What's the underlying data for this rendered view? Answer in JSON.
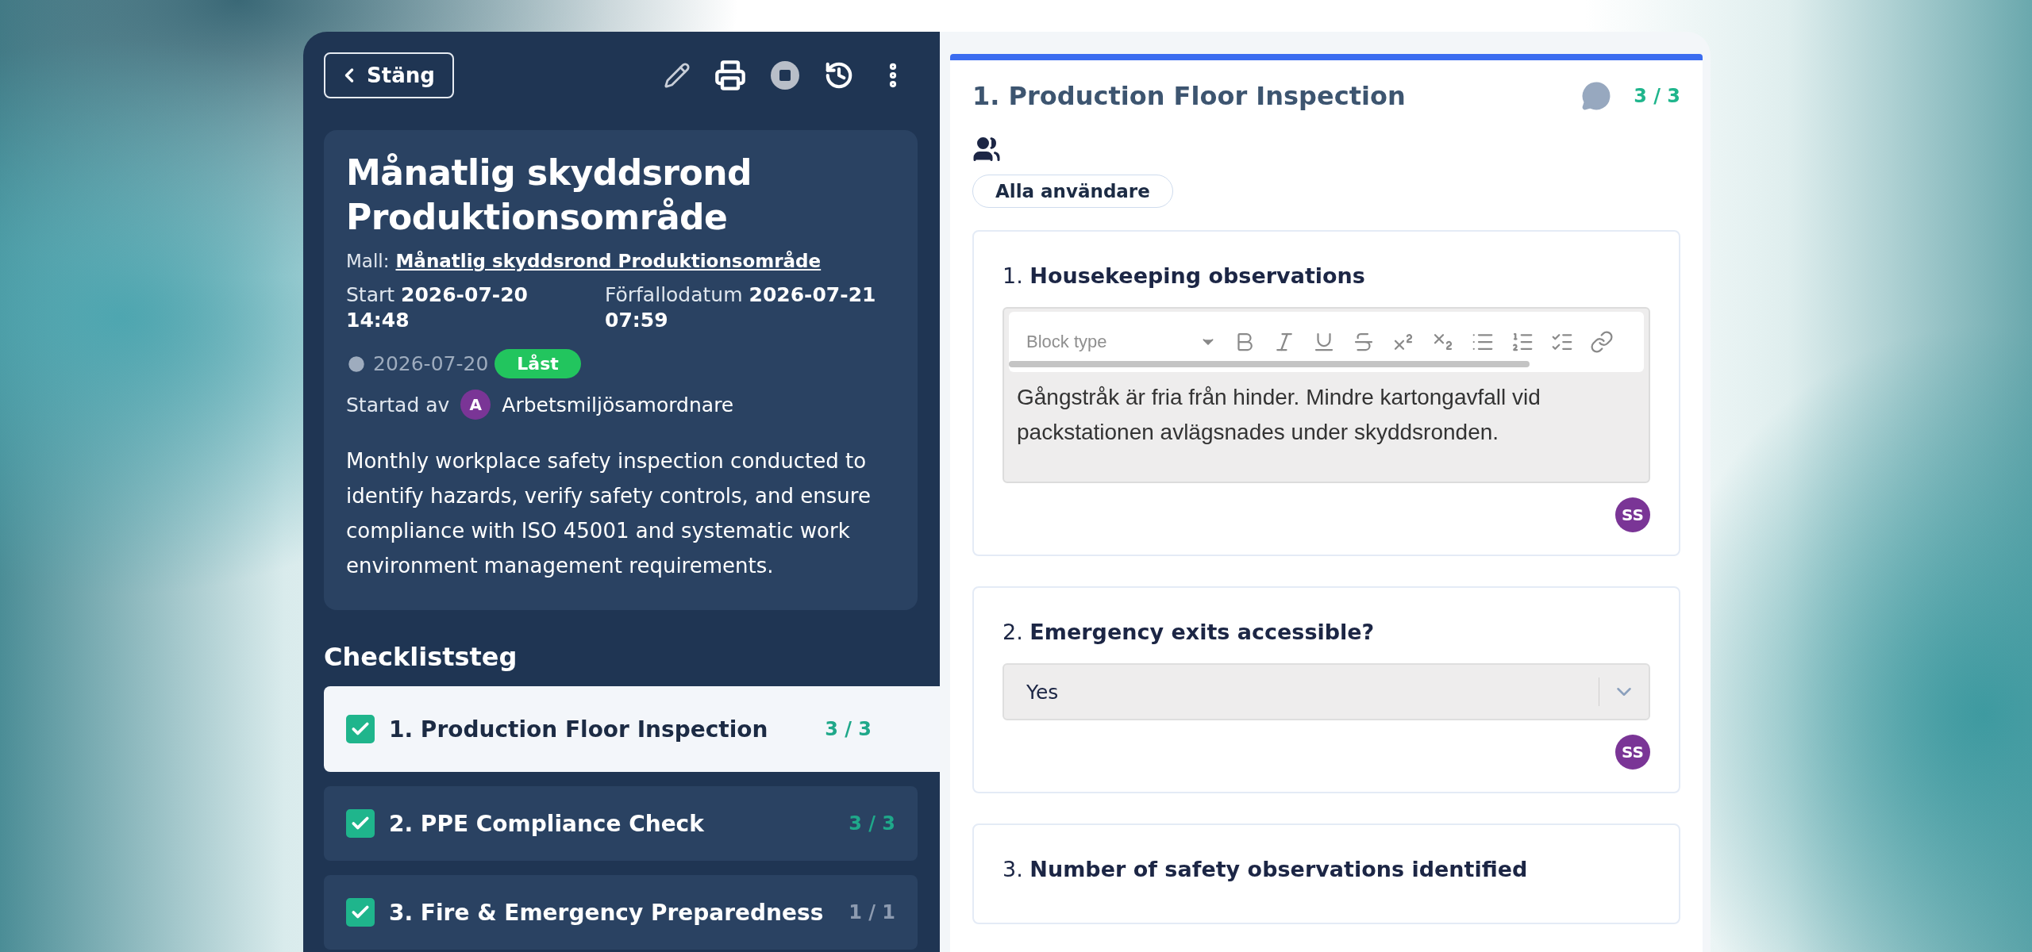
{
  "header": {
    "close_button": "Stäng"
  },
  "checklist": {
    "title": "Månatlig skyddsrond Produktionsområde",
    "template_label": "Mall:",
    "template_name": "Månatlig skyddsrond Produktionsområde",
    "start_label": "Start",
    "start_value": "2026-07-20 14:48",
    "due_label": "Förfallodatum",
    "due_value": "2026-07-21 07:59",
    "date": "2026-07-20",
    "status": "Låst",
    "started_by_label": "Startad av",
    "started_by_initial": "A",
    "started_by_name": "Arbetsmiljösamordnare",
    "description": "Monthly workplace safety inspection conducted to identify hazards, verify safety controls, and ensure compliance with ISO 45001 and systematic work environment management requirements."
  },
  "steps_heading": "Checkliststeg",
  "steps": [
    {
      "label": "1. Production Floor Inspection",
      "count": "3 / 3",
      "checked": true,
      "selected": true,
      "color": "#1fa88a"
    },
    {
      "label": "2. PPE Compliance Check",
      "count": "3 / 3",
      "checked": true,
      "selected": false,
      "color": "#1fa88a"
    },
    {
      "label": "3. Fire & Emergency Preparedness",
      "count": "1 / 1",
      "checked": true,
      "selected": false,
      "color": "#8d9bb0"
    }
  ],
  "section": {
    "title": "1. Production Floor Inspection",
    "count": "3 / 3",
    "audience": "Alla användare"
  },
  "questions": [
    {
      "number": "1.",
      "text": "Housekeeping observations",
      "kind": "richtext",
      "placeholder": "Block type",
      "value": "Gångstråk är fria från hinder. Mindre kartongavfall vid packstationen avlägsnades under skyddsronden.",
      "answered_by": "SS"
    },
    {
      "number": "2.",
      "text": "Emergency exits accessible?",
      "kind": "select",
      "value": "Yes",
      "answered_by": "SS"
    },
    {
      "number": "3.",
      "text": "Number of safety observations identified",
      "kind": "number"
    }
  ]
}
